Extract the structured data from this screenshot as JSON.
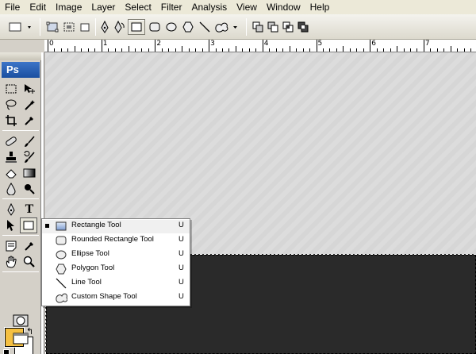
{
  "menu": [
    "File",
    "Edit",
    "Image",
    "Layer",
    "Select",
    "Filter",
    "Analysis",
    "View",
    "Window",
    "Help"
  ],
  "toolbox": {
    "logo": "Ps",
    "text_tool_glyph": "T"
  },
  "ruler": {
    "labels": [
      "0",
      "1",
      "2",
      "3",
      "4",
      "5",
      "6",
      "7"
    ]
  },
  "flyout": {
    "items": [
      {
        "label": "Rectangle Tool",
        "key": "U",
        "icon": "rectangle-icon",
        "active": true
      },
      {
        "label": "Rounded Rectangle Tool",
        "key": "U",
        "icon": "rounded-rectangle-icon",
        "active": false
      },
      {
        "label": "Ellipse Tool",
        "key": "U",
        "icon": "ellipse-icon",
        "active": false
      },
      {
        "label": "Polygon Tool",
        "key": "U",
        "icon": "polygon-icon",
        "active": false
      },
      {
        "label": "Line Tool",
        "key": "U",
        "icon": "line-icon",
        "active": false
      },
      {
        "label": "Custom Shape Tool",
        "key": "U",
        "icon": "custom-shape-icon",
        "active": false
      }
    ]
  },
  "colors": {
    "foreground": "#f5c042",
    "background": "#ffffff",
    "document_fill": "#2a2a2a"
  }
}
